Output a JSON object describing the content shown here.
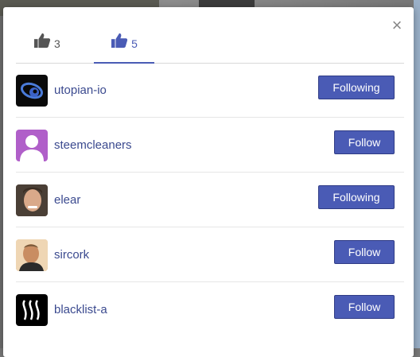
{
  "dialog": {
    "close_label": "×",
    "tabs": [
      {
        "icon": "thumbs-up-icon",
        "count": "3"
      },
      {
        "icon": "thumbs-up-icon",
        "count": "5"
      }
    ],
    "accent": "#4a5bb5"
  },
  "voters": [
    {
      "name": "utopian-io",
      "avatar": "utopian-logo",
      "button": "Following"
    },
    {
      "name": "steemcleaners",
      "avatar": "default-user-avatar",
      "button": "Follow"
    },
    {
      "name": "elear",
      "avatar": "user-photo",
      "button": "Following"
    },
    {
      "name": "sircork",
      "avatar": "user-photo",
      "button": "Follow"
    },
    {
      "name": "blacklist-a",
      "avatar": "steem-logo",
      "button": "Follow"
    }
  ]
}
